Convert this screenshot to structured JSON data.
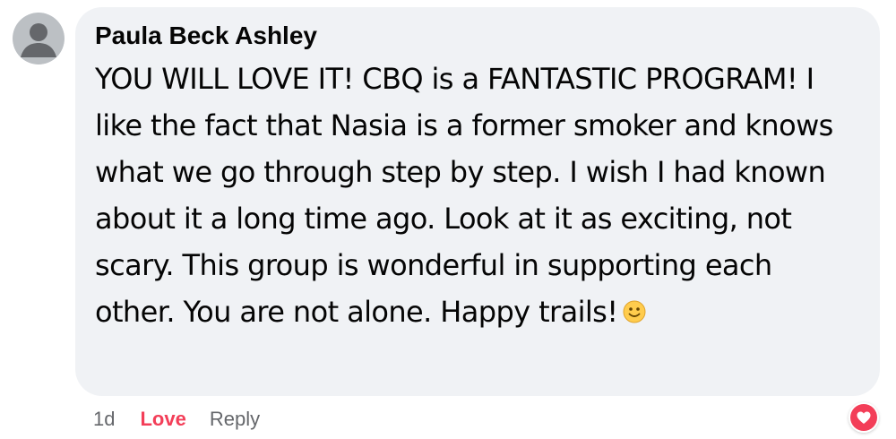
{
  "comment": {
    "author": "Paula Beck Ashley",
    "text": "YOU WILL LOVE IT! CBQ is a FANTASTIC PROGRAM! I like the fact that Nasia is a former smoker and knows what we go through step by step. I wish I had known about it a long time ago. Look at it as exciting, not scary. This group is wonderful in supporting each other. You are not alone. Happy trails!",
    "emoji_icon": "slightly-smiling-face-icon",
    "reaction_icon": "heart-reaction-icon"
  },
  "actions": {
    "time": "1d",
    "love_label": "Love",
    "reply_label": "Reply"
  },
  "colors": {
    "bubble": "#f0f2f5",
    "love": "#f33e58",
    "secondary_text": "#65676b"
  }
}
